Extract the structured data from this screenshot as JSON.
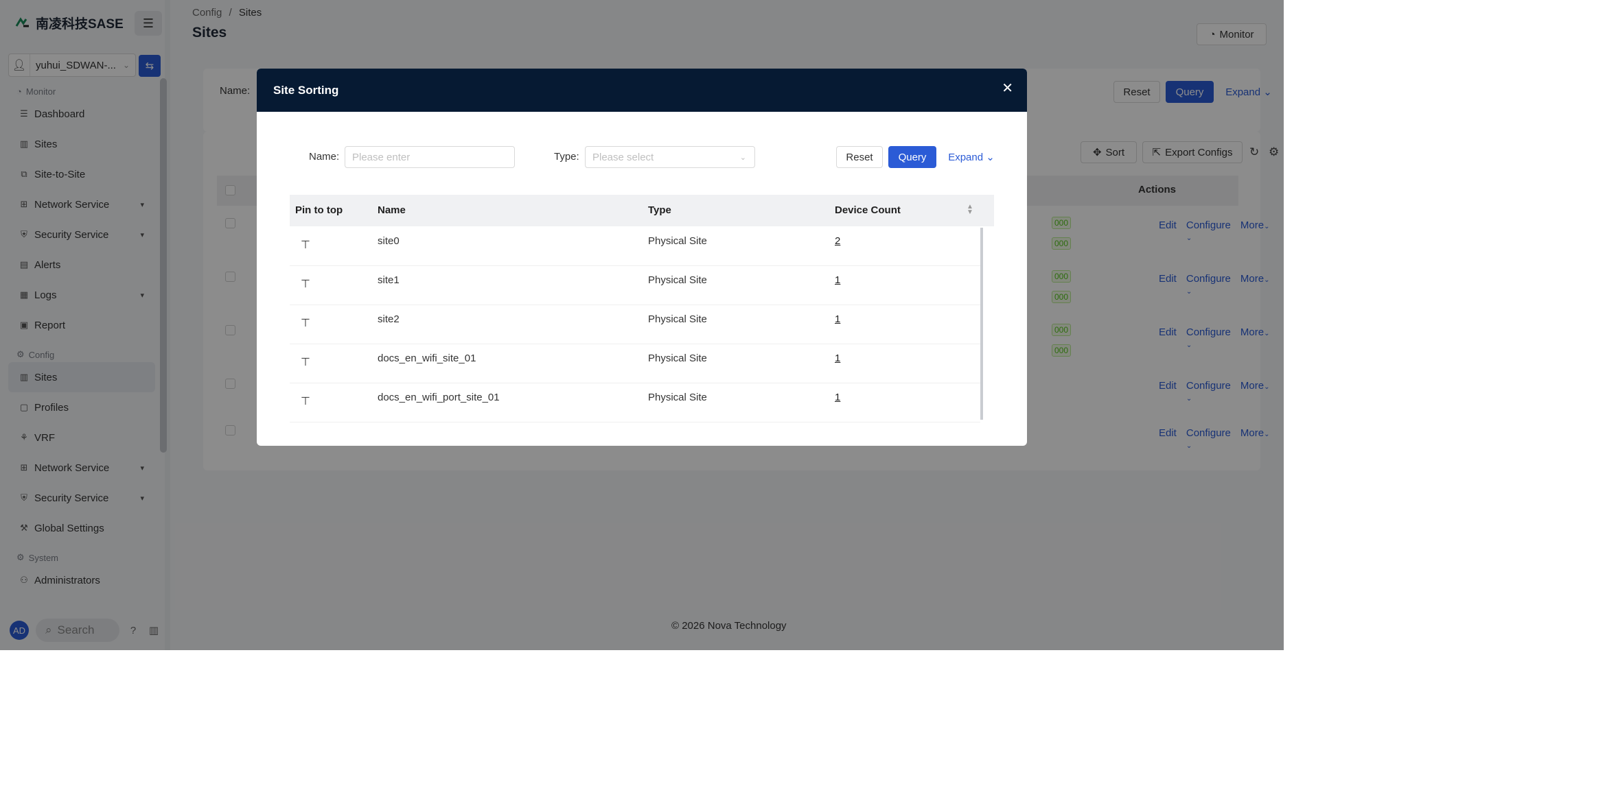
{
  "brand": {
    "name": "南凌科技SASE"
  },
  "tenant": {
    "name": "yuhui_SDWAN-..."
  },
  "sidebar": {
    "monitor_title": "Monitor",
    "monitor_items": [
      {
        "label": "Dashboard"
      },
      {
        "label": "Sites"
      },
      {
        "label": "Site-to-Site"
      },
      {
        "label": "Network Service"
      },
      {
        "label": "Security Service"
      },
      {
        "label": "Alerts"
      },
      {
        "label": "Logs"
      },
      {
        "label": "Report"
      }
    ],
    "config_title": "Config",
    "config_items": [
      {
        "label": "Sites"
      },
      {
        "label": "Profiles"
      },
      {
        "label": "VRF"
      },
      {
        "label": "Network Service"
      },
      {
        "label": "Security Service"
      },
      {
        "label": "Global Settings"
      }
    ],
    "system_title": "System",
    "system_items": [
      {
        "label": "Administrators"
      }
    ],
    "avatar_initials": "AD",
    "search_label": "Search"
  },
  "breadcrumb": {
    "parent": "Config",
    "separator": "/",
    "current": "Sites"
  },
  "page": {
    "title": "Sites",
    "monitor_button": "Monitor",
    "filter_name_label": "Name",
    "reset_label": "Reset",
    "query_label": "Query",
    "expand_label": "Expand",
    "sort_label": "Sort",
    "export_label": "Export Configs",
    "actions_header": "Actions",
    "row_actions": {
      "edit": "Edit",
      "configure": "Configure",
      "more": "More"
    },
    "badge_text": "000",
    "footer": "© 2026 Nova Technology"
  },
  "modal": {
    "title": "Site Sorting",
    "name_label": "Name",
    "name_placeholder": "Please enter",
    "type_label": "Type",
    "type_placeholder": "Please select",
    "reset_label": "Reset",
    "query_label": "Query",
    "expand_label": "Expand",
    "columns": {
      "pin": "Pin to top",
      "name": "Name",
      "type": "Type",
      "count": "Device Count"
    },
    "rows": [
      {
        "name": "site0",
        "type": "Physical Site",
        "count": "2"
      },
      {
        "name": "site1",
        "type": "Physical Site",
        "count": "1"
      },
      {
        "name": "site2",
        "type": "Physical Site",
        "count": "1"
      },
      {
        "name": "docs_en_wifi_site_01",
        "type": "Physical Site",
        "count": "1"
      },
      {
        "name": "docs_en_wifi_port_site_01",
        "type": "Physical Site",
        "count": "1"
      }
    ]
  },
  "colors": {
    "primary": "#2b5bd6",
    "modal_header": "#061a33",
    "accent_green": "#52c41a"
  }
}
